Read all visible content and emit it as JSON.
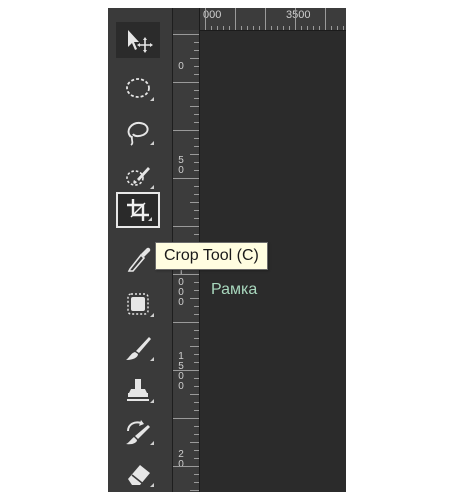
{
  "tooltip": {
    "text": "Crop Tool (C)"
  },
  "caption": {
    "text": "Рамка"
  },
  "ruler_top": {
    "labels": [
      "000",
      "3500"
    ]
  },
  "ruler_left": {
    "labels": [
      "0",
      "5\n0",
      "1\n0\n0\n0",
      "1\n5\n0\n0",
      "2\n0"
    ]
  },
  "toolbar": {
    "tools": [
      {
        "name": "move-tool",
        "icon": "move-icon",
        "active": false
      },
      {
        "name": "elliptical-marquee-tool",
        "icon": "ellipse-marquee-icon",
        "active": false
      },
      {
        "name": "lasso-tool",
        "icon": "lasso-icon",
        "active": false
      },
      {
        "name": "quick-selection-tool",
        "icon": "quick-selection-brush-icon",
        "active": false
      },
      {
        "name": "crop-tool",
        "icon": "crop-icon",
        "active": true
      },
      {
        "name": "eyedropper-tool",
        "icon": "eyedropper-icon",
        "active": false
      },
      {
        "name": "spot-healing-tool",
        "icon": "healing-patch-icon",
        "active": false
      },
      {
        "name": "brush-tool",
        "icon": "brush-icon",
        "active": false
      },
      {
        "name": "clone-stamp-tool",
        "icon": "stamp-icon",
        "active": false
      },
      {
        "name": "history-brush-tool",
        "icon": "history-brush-icon",
        "active": false
      },
      {
        "name": "eraser-tool",
        "icon": "eraser-icon",
        "active": false
      }
    ]
  },
  "colors": {
    "panel": "#2c2c2c",
    "toolbar": "#3a3a3a",
    "tooltip_bg": "#fffde0",
    "caption": "#a8d7bd"
  }
}
